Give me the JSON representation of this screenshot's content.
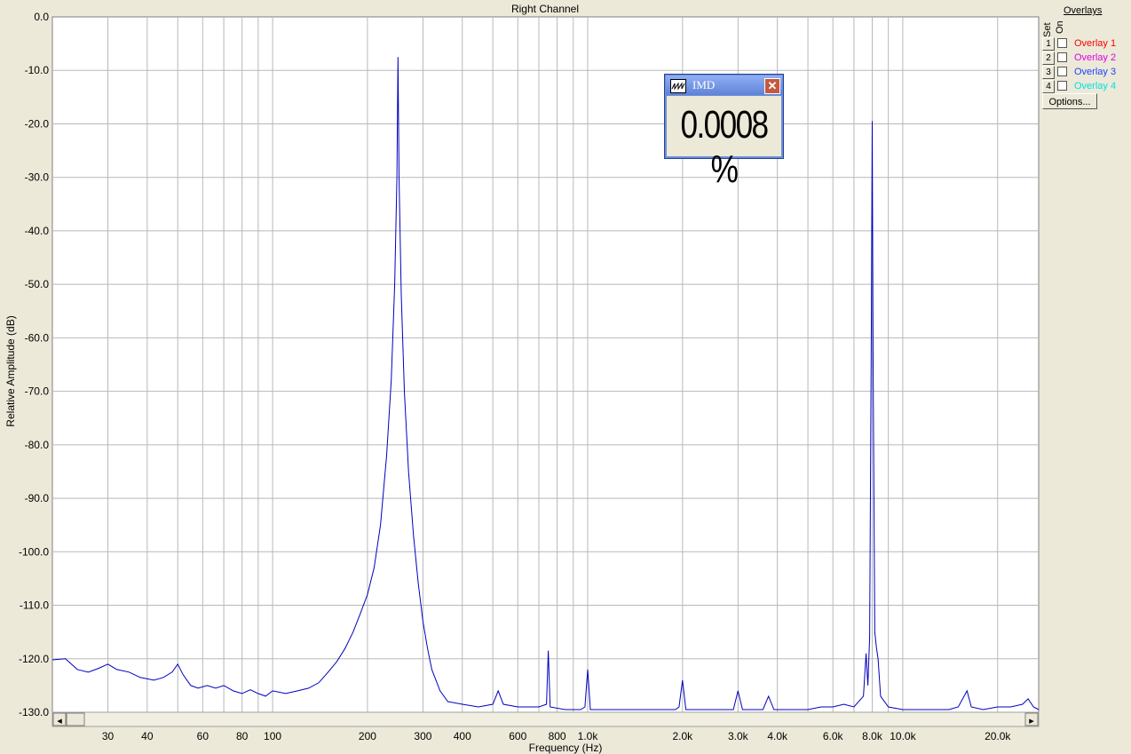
{
  "colors": {
    "plot_background": "#ffffff",
    "panel_background": "#ece9d8",
    "trace": "#0000c0",
    "grid": "#b8b8b8",
    "window_title_bar": "#6d8ed6",
    "overlay_1": "#ff0000",
    "overlay_2": "#e000e0",
    "overlay_3": "#2040ff",
    "overlay_4": "#00e0e0"
  },
  "overlays": {
    "title": "Overlays",
    "set_label": "Set",
    "on_label": "On",
    "items": [
      {
        "set": "1",
        "label": "Overlay 1",
        "checked": false
      },
      {
        "set": "2",
        "label": "Overlay 2",
        "checked": false
      },
      {
        "set": "3",
        "label": "Overlay 3",
        "checked": false
      },
      {
        "set": "4",
        "label": "Overlay 4",
        "checked": false
      }
    ],
    "options_button": "Options..."
  },
  "imd_window": {
    "title": "IMD",
    "value": "0.0008 %",
    "icon": "waveform-icon",
    "close_icon": "close-icon"
  },
  "scrollbar": {
    "left_arrow": "◂",
    "right_arrow": "▸"
  },
  "chart_data": {
    "type": "line",
    "title": "Right Channel",
    "xlabel": "Frequency (Hz)",
    "ylabel": "Relative Amplitude (dB)",
    "xscale": "log",
    "xlim": [
      20,
      27000
    ],
    "ylim": [
      -130,
      0
    ],
    "grid": true,
    "yticks": [
      0,
      -10,
      -20,
      -30,
      -40,
      -50,
      -60,
      -70,
      -80,
      -90,
      -100,
      -110,
      -120,
      -130
    ],
    "ytick_labels": [
      "0.0",
      "-10.0",
      "-20.0",
      "-30.0",
      "-40.0",
      "-50.0",
      "-60.0",
      "-70.0",
      "-80.0",
      "-90.0",
      "-100.0",
      "-110.0",
      "-120.0",
      "-130.0"
    ],
    "xticks": [
      {
        "value": 30,
        "label": "30"
      },
      {
        "value": 40,
        "label": "40"
      },
      {
        "value": 60,
        "label": "60"
      },
      {
        "value": 80,
        "label": "80"
      },
      {
        "value": 100,
        "label": "100"
      },
      {
        "value": 200,
        "label": "200"
      },
      {
        "value": 300,
        "label": "300"
      },
      {
        "value": 400,
        "label": "400"
      },
      {
        "value": 600,
        "label": "600"
      },
      {
        "value": 800,
        "label": "800"
      },
      {
        "value": 1000,
        "label": "1.0k"
      },
      {
        "value": 2000,
        "label": "2.0k"
      },
      {
        "value": 3000,
        "label": "3.0k"
      },
      {
        "value": 4000,
        "label": "4.0k"
      },
      {
        "value": 6000,
        "label": "6.0k"
      },
      {
        "value": 8000,
        "label": "8.0k"
      },
      {
        "value": 10000,
        "label": "10.0k"
      },
      {
        "value": 20000,
        "label": "20.0k"
      }
    ],
    "series": [
      {
        "points": [
          [
            20,
            -120.2
          ],
          [
            22,
            -120
          ],
          [
            24,
            -122
          ],
          [
            26,
            -122.5
          ],
          [
            28,
            -121.8
          ],
          [
            30,
            -121
          ],
          [
            32,
            -122
          ],
          [
            35,
            -122.5
          ],
          [
            38,
            -123.5
          ],
          [
            42,
            -124
          ],
          [
            45,
            -123.5
          ],
          [
            48,
            -122.5
          ],
          [
            50,
            -121
          ],
          [
            52,
            -123
          ],
          [
            55,
            -125
          ],
          [
            58,
            -125.5
          ],
          [
            62,
            -125
          ],
          [
            66,
            -125.5
          ],
          [
            70,
            -125
          ],
          [
            75,
            -126
          ],
          [
            80,
            -126.5
          ],
          [
            85,
            -125.8
          ],
          [
            90,
            -126.5
          ],
          [
            95,
            -127
          ],
          [
            100,
            -126
          ],
          [
            110,
            -126.5
          ],
          [
            120,
            -126
          ],
          [
            130,
            -125.5
          ],
          [
            140,
            -124.5
          ],
          [
            150,
            -122.5
          ],
          [
            160,
            -120.5
          ],
          [
            170,
            -118
          ],
          [
            180,
            -115
          ],
          [
            190,
            -111.5
          ],
          [
            200,
            -108
          ],
          [
            210,
            -103
          ],
          [
            220,
            -95
          ],
          [
            230,
            -82
          ],
          [
            238,
            -68
          ],
          [
            244,
            -50
          ],
          [
            248,
            -30
          ],
          [
            250,
            -7.5
          ],
          [
            252,
            -30
          ],
          [
            256,
            -52
          ],
          [
            262,
            -70
          ],
          [
            270,
            -85
          ],
          [
            280,
            -97
          ],
          [
            290,
            -106
          ],
          [
            300,
            -113
          ],
          [
            310,
            -118
          ],
          [
            320,
            -122
          ],
          [
            340,
            -126
          ],
          [
            360,
            -128
          ],
          [
            400,
            -128.5
          ],
          [
            450,
            -129
          ],
          [
            500,
            -128.5
          ],
          [
            520,
            -126
          ],
          [
            540,
            -128.5
          ],
          [
            600,
            -129
          ],
          [
            700,
            -129
          ],
          [
            740,
            -128.5
          ],
          [
            750,
            -118.5
          ],
          [
            760,
            -129
          ],
          [
            850,
            -129.5
          ],
          [
            950,
            -129.5
          ],
          [
            980,
            -129
          ],
          [
            1000,
            -122
          ],
          [
            1020,
            -129.5
          ],
          [
            1200,
            -129.5
          ],
          [
            1500,
            -129.5
          ],
          [
            1900,
            -129.5
          ],
          [
            1950,
            -129
          ],
          [
            2000,
            -124
          ],
          [
            2050,
            -129.5
          ],
          [
            2500,
            -129.5
          ],
          [
            2900,
            -129.5
          ],
          [
            3000,
            -126
          ],
          [
            3100,
            -129.5
          ],
          [
            3600,
            -129.5
          ],
          [
            3750,
            -127
          ],
          [
            3900,
            -129.5
          ],
          [
            4500,
            -129.5
          ],
          [
            5000,
            -129.5
          ],
          [
            5500,
            -129
          ],
          [
            6000,
            -129
          ],
          [
            6500,
            -128.5
          ],
          [
            7000,
            -129
          ],
          [
            7500,
            -127
          ],
          [
            7650,
            -119
          ],
          [
            7750,
            -125
          ],
          [
            7850,
            -116
          ],
          [
            7950,
            -58
          ],
          [
            8000,
            -19.5
          ],
          [
            8050,
            -65
          ],
          [
            8150,
            -115
          ],
          [
            8250,
            -118
          ],
          [
            8350,
            -120
          ],
          [
            8500,
            -127
          ],
          [
            9000,
            -129
          ],
          [
            10000,
            -129.5
          ],
          [
            12000,
            -129.5
          ],
          [
            14000,
            -129.5
          ],
          [
            15000,
            -129
          ],
          [
            16000,
            -126
          ],
          [
            16500,
            -129
          ],
          [
            18000,
            -129.5
          ],
          [
            20000,
            -129
          ],
          [
            22000,
            -129
          ],
          [
            24000,
            -128.5
          ],
          [
            25000,
            -127.5
          ],
          [
            26000,
            -129
          ],
          [
            27000,
            -129.5
          ]
        ]
      }
    ]
  }
}
